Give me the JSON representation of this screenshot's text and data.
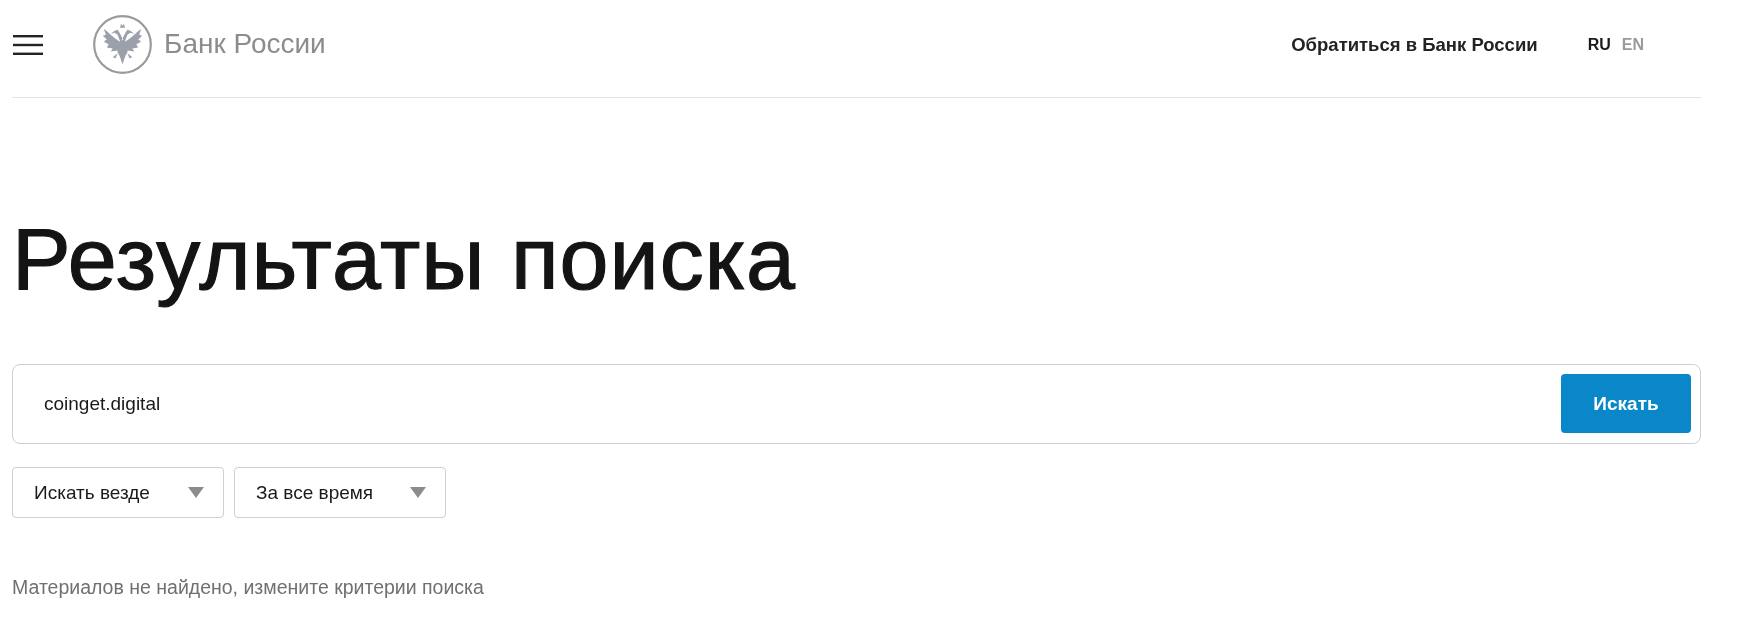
{
  "header": {
    "logo_text": "Банк России",
    "contact_link": "Обратиться в Банк России",
    "languages": [
      {
        "label": "RU",
        "selected": true
      },
      {
        "label": "EN",
        "selected": false
      }
    ]
  },
  "page_title": "Результаты поиска",
  "search": {
    "value": "coinget.digital",
    "button": "Искать"
  },
  "filters": [
    {
      "label": "Искать везде"
    },
    {
      "label": "За все время"
    }
  ],
  "message": "Материалов не найдено, измените критерии поиска"
}
